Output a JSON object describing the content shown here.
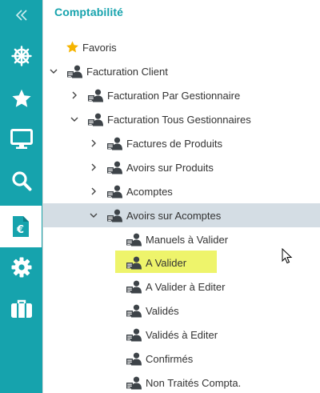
{
  "rail": {
    "items": [
      {
        "id": "collapse",
        "icon": "double-chevron-left-icon"
      },
      {
        "id": "dashboard",
        "icon": "ship-wheel-icon"
      },
      {
        "id": "favorites",
        "icon": "star-icon"
      },
      {
        "id": "monitor",
        "icon": "monitor-icon"
      },
      {
        "id": "search",
        "icon": "search-icon"
      },
      {
        "id": "accounting",
        "icon": "euro-document-icon",
        "active": true
      },
      {
        "id": "settings",
        "icon": "gear-icon"
      },
      {
        "id": "briefcase",
        "icon": "briefcase-icon"
      }
    ],
    "color": "#16a3ad"
  },
  "panel": {
    "title": "Comptabilité"
  },
  "tree": {
    "favoris": "Favoris",
    "facturation_client": "Facturation Client",
    "facturation_par_gestionnaire": "Facturation Par Gestionnaire",
    "facturation_tous_gestionnaires": "Facturation Tous Gestionnaires",
    "factures_de_produits": "Factures de Produits",
    "avoirs_sur_produits": "Avoirs sur Produits",
    "acomptes": "Acomptes",
    "avoirs_sur_acomptes": "Avoirs sur Acomptes",
    "manuels_a_valider": "Manuels à Valider",
    "a_valider": "A Valider",
    "a_valider_a_editer": "A Valider à Editer",
    "valides": "Validés",
    "valides_a_editer": "Validés à Editer",
    "confirmes": "Confirmés",
    "non_traites_compta": "Non Traités Compta."
  },
  "colors": {
    "accent": "#16a3ad",
    "selected_row": "#d4dde4",
    "highlight": "#eef46b",
    "star": "#f5b400"
  }
}
